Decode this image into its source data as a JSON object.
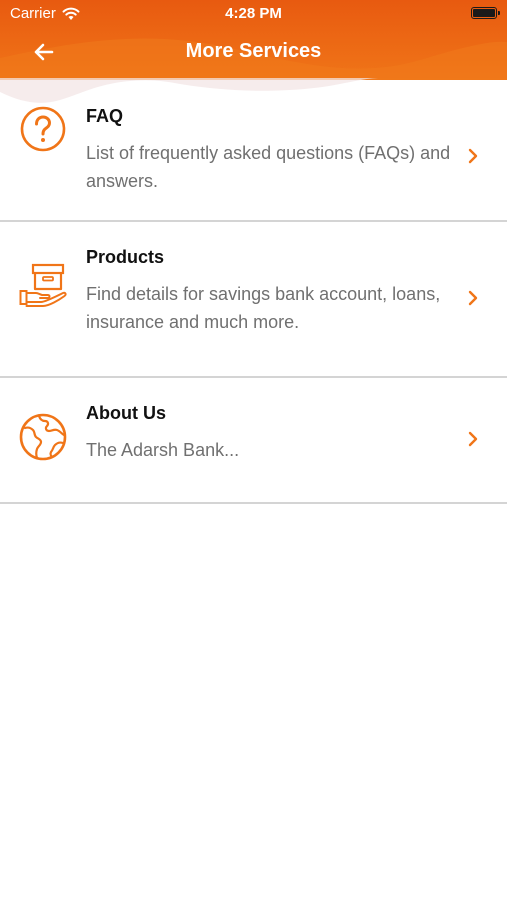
{
  "status_bar": {
    "carrier": "Carrier",
    "time": "4:28 PM",
    "wifi_icon": "wifi-icon",
    "battery_icon": "battery-icon"
  },
  "nav": {
    "title": "More Services",
    "back_icon": "arrow-left-icon"
  },
  "theme": {
    "accent": "#f07518",
    "header_top": "#e85a10",
    "title_color": "#111111",
    "desc_color": "#707070",
    "divider": "#d4d4d4"
  },
  "services": [
    {
      "title": "FAQ",
      "description": "List of frequently asked questions (FAQs) and answers.",
      "icon": "question-circle-icon"
    },
    {
      "title": "Products",
      "description": "Find details for savings bank account, loans, insurance and much more.",
      "icon": "box-in-hand-icon"
    },
    {
      "title": "About Us",
      "description": "The Adarsh Bank...",
      "icon": "globe-icon"
    }
  ]
}
